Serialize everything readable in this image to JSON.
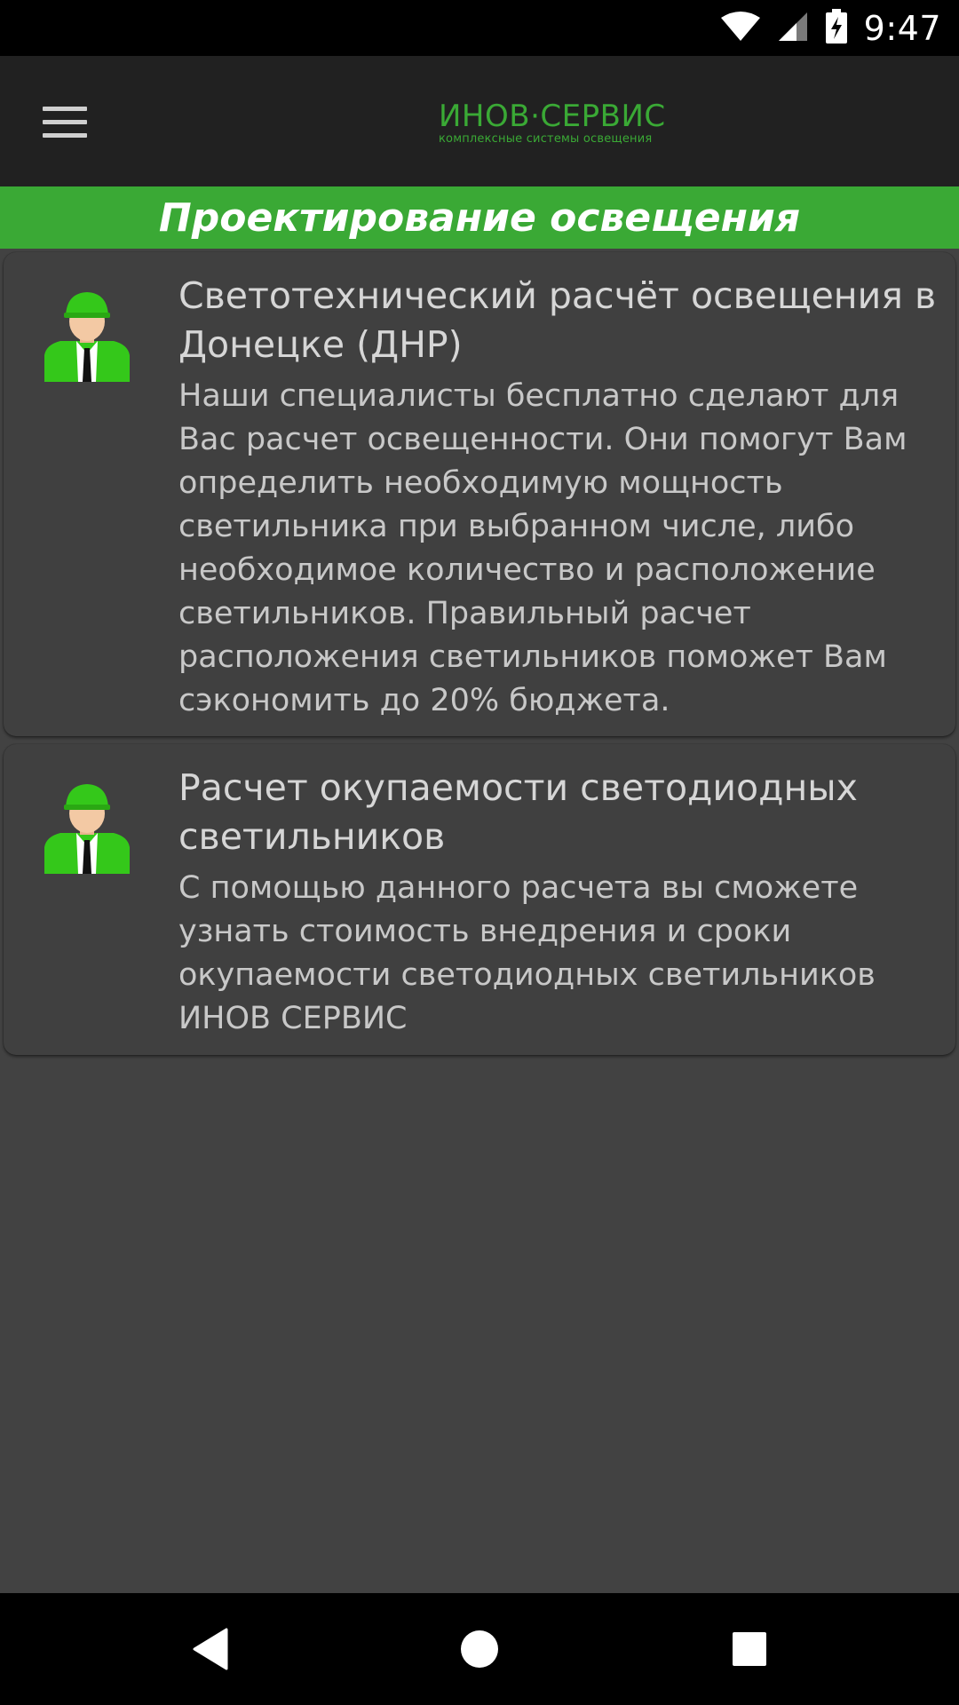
{
  "status_bar": {
    "time": "9:47",
    "icons": [
      "wifi-icon",
      "signal-icon",
      "battery-charging-icon"
    ]
  },
  "toolbar": {
    "menu_icon": "hamburger-menu-icon",
    "logo_name": "ИНОВ·СЕРВИС",
    "logo_tagline": "комплексные системы освещения"
  },
  "section": {
    "title": "Проектирование освещения"
  },
  "colors": {
    "accent_green": "#3aa935",
    "toolbar_bg": "#212121",
    "card_bg": "#404040",
    "page_bg": "#424242"
  },
  "cards": [
    {
      "icon": "engineer-avatar-icon",
      "title": "Светотехнический расчёт освещения в Донецке (ДНР)",
      "description": "Наши специалисты бесплатно сделают для Вас расчет освещенности. Они помогут Вам определить необходимую мощность светильника при выбранном числе, либо необходимое количество и расположение светильников. Правильный расчет расположения светильников поможет Вам сэкономить до 20% бюджета."
    },
    {
      "icon": "engineer-avatar-icon",
      "title": "Расчет окупаемости светодиодных светильников",
      "description": "С помощью данного расчета вы сможете узнать стоимость внедрения и сроки окупаемости светодиодных светильников ИНОВ СЕРВИС"
    }
  ],
  "nav_bar": {
    "buttons": [
      "back-icon",
      "home-icon",
      "recents-icon"
    ]
  }
}
